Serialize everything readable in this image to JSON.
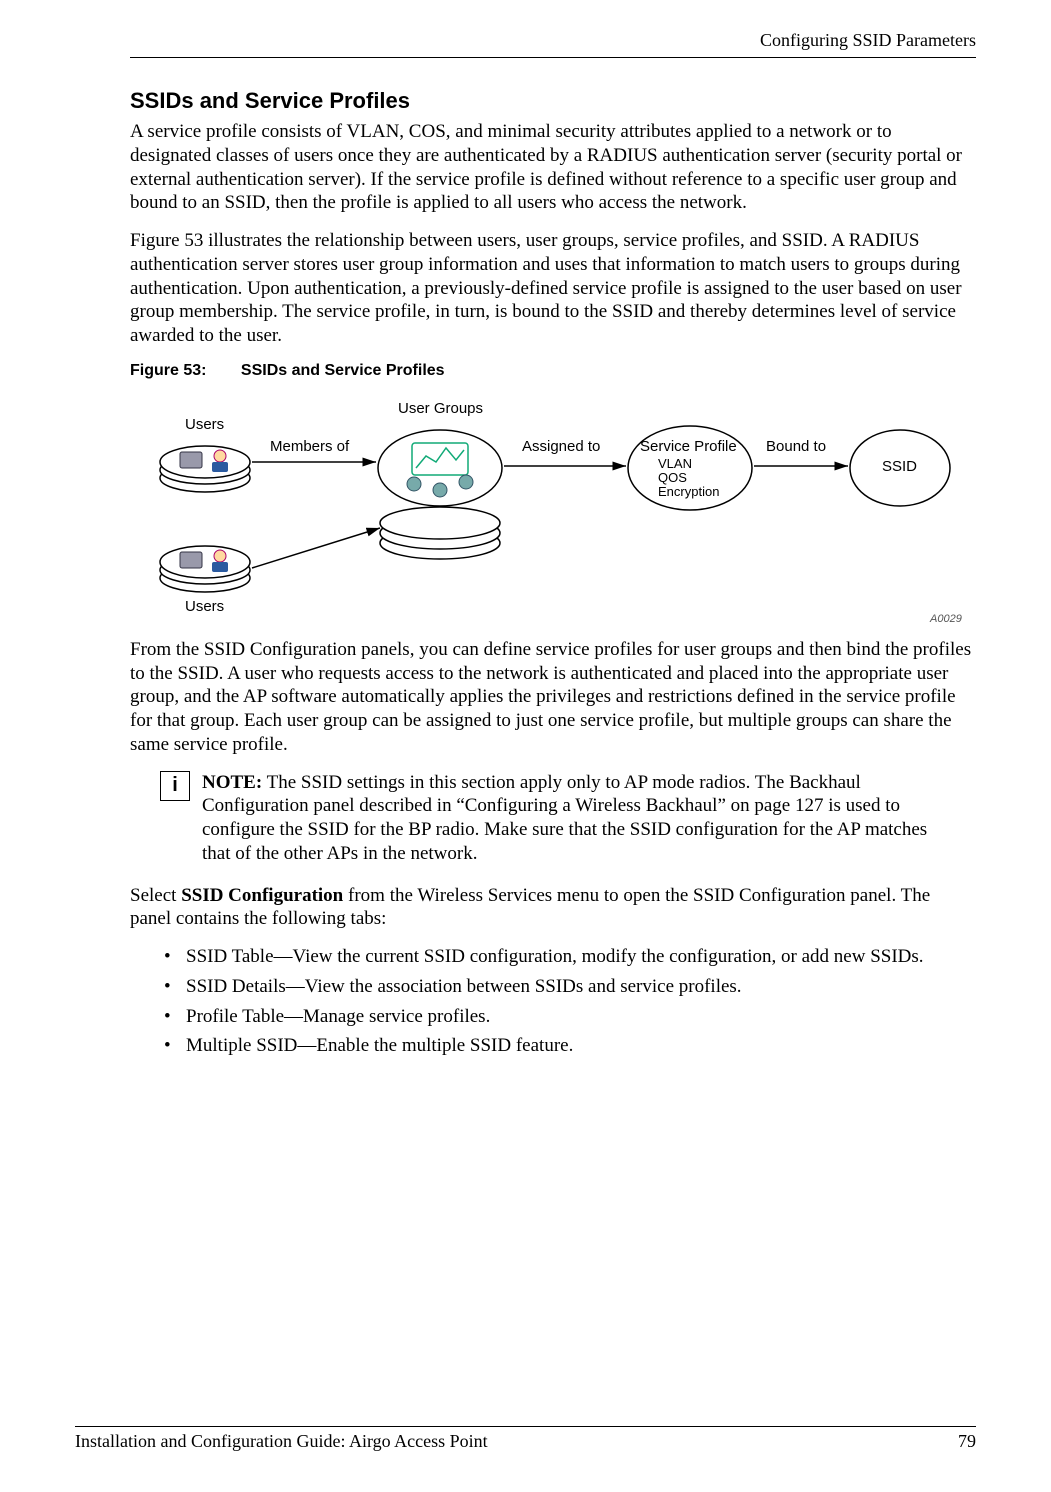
{
  "header": {
    "running_head": "Configuring SSID Parameters"
  },
  "section": {
    "title": "SSIDs and Service Profiles",
    "para1": "A service profile consists of VLAN, COS, and minimal security attributes applied to a network or to designated classes of users once they are authenticated by a RADIUS authentication server (security portal or external authentication server). If the service profile is defined without reference to a specific user group and bound to an SSID, then the profile is applied to all users who access the network.",
    "para2": "Figure 53 illustrates the relationship between users, user groups, service profiles, and SSID. A RADIUS authentication server stores user group information and uses that information to match users to groups during authentication. Upon authentication, a previously-defined service profile is assigned to the user based on user group membership. The service profile, in turn, is bound to the SSID and thereby determines level of service awarded to the user."
  },
  "figure": {
    "number": "Figure 53:",
    "title": "SSIDs and Service Profiles",
    "labels": {
      "users_top": "Users",
      "users_bottom": "Users",
      "user_groups": "User Groups",
      "members_of": "Members of",
      "assigned_to": "Assigned to",
      "bound_to": "Bound to",
      "service_profile": "Service Profile",
      "vlan": "VLAN",
      "qos": "QOS",
      "encryption": "Encryption",
      "ssid": "SSID"
    },
    "id": "A0029"
  },
  "after_figure": {
    "para": "From the SSID Configuration panels, you can define service profiles for user groups and then bind the profiles to the SSID. A user who requests access to the network is authenticated and placed into the appropriate user group, and the AP software automatically applies the privileges and restrictions defined in the service profile for that group. Each user group can be assigned to just one service profile, but multiple groups can share the same service profile."
  },
  "note": {
    "label": "NOTE:",
    "text": " The SSID settings in this section apply only to AP mode radios. The Backhaul Configuration panel described in “Configuring a Wireless Backhaul” on page 127 is used to configure the SSID for the BP radio. Make sure that the SSID configuration for the AP matches that of the other APs in the network.",
    "icon_char": "i"
  },
  "select_para": {
    "prefix": "Select ",
    "bold": "SSID Configuration",
    "suffix": " from the Wireless Services menu to open the SSID Configuration panel. The panel contains the following tabs:"
  },
  "tabs": [
    "SSID Table—View the current SSID configuration, modify the configuration, or add new SSIDs.",
    "SSID Details—View the association between SSIDs and service profiles.",
    "Profile Table—Manage service profiles.",
    "Multiple SSID—Enable the multiple SSID feature."
  ],
  "footer": {
    "left": "Installation and Configuration Guide: Airgo Access Point",
    "right": "79"
  }
}
